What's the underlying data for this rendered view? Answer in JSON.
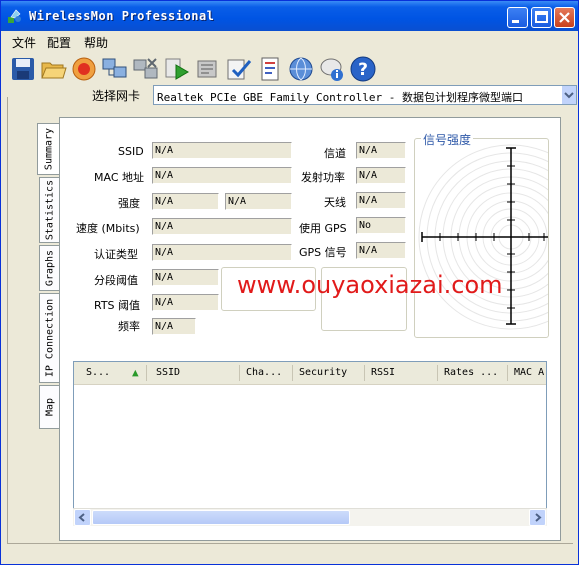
{
  "app": {
    "title": "WirelessMon Professional"
  },
  "menu": {
    "items": [
      "文件",
      "配置",
      "帮助"
    ]
  },
  "toolbar": {
    "icons": [
      "save-icon",
      "open-folder-icon",
      "record-icon",
      "network-icon",
      "disconnect-icon",
      "play-icon",
      "log-icon",
      "check-icon",
      "report-icon",
      "globe-icon",
      "chat-info-icon",
      "help-icon"
    ]
  },
  "nic": {
    "label": "选择网卡",
    "value": "Realtek PCIe GBE Family Controller - 数据包计划程序微型端口"
  },
  "tabs": [
    "Summary",
    "Statistics",
    "Graphs",
    "IP Connection",
    "Map"
  ],
  "summary": {
    "ssid": {
      "label": "SSID",
      "value": "N/A"
    },
    "mac": {
      "label": "MAC 地址",
      "value": "N/A"
    },
    "strength": {
      "label": "强度",
      "value": "N/A",
      "value2": "N/A"
    },
    "speed": {
      "label": "速度 (Mbits)",
      "value": "N/A"
    },
    "auth": {
      "label": "认证类型",
      "value": "N/A"
    },
    "frag": {
      "label": "分段阈值",
      "value": "N/A"
    },
    "rts": {
      "label": "RTS 阈值",
      "value": "N/A"
    },
    "freq": {
      "label": "频率",
      "value": "N/A"
    },
    "channel": {
      "label": "信道",
      "value": "N/A"
    },
    "txpower": {
      "label": "发射功率",
      "value": "N/A"
    },
    "antenna": {
      "label": "天线",
      "value": "N/A"
    },
    "usegps": {
      "label": "使用 GPS",
      "value": "No"
    },
    "gpssignal": {
      "label": "GPS 信号",
      "value": "N/A"
    },
    "signal_title": "信号强度"
  },
  "table": {
    "columns": [
      "S...",
      "SSID",
      "Cha...",
      "Security",
      "RSSI",
      "Rates ...",
      "MAC A"
    ],
    "sort_indicator": "▲"
  },
  "watermark": "www.ouyaoxiazai.com"
}
